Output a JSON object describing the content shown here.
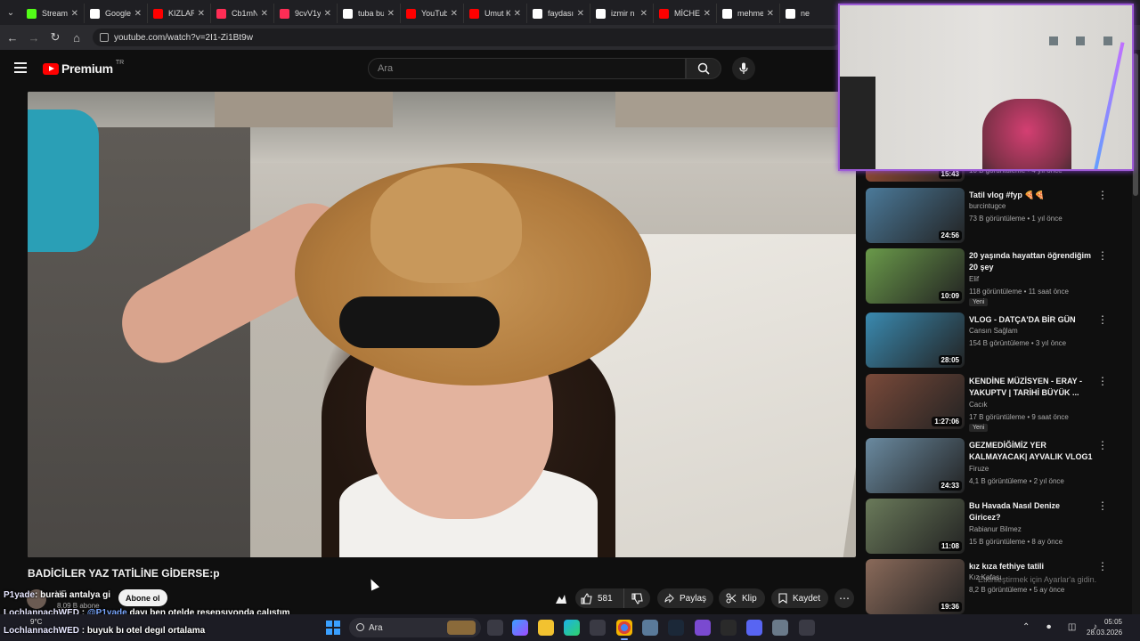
{
  "browser": {
    "tabs": [
      {
        "label": "Stream",
        "icon": "green-k-icon",
        "color": "#53fc18"
      },
      {
        "label": "Google",
        "icon": "google-icon",
        "color": "#ffffff"
      },
      {
        "label": "KIZLAR",
        "icon": "youtube-icon",
        "color": "#ff0000"
      },
      {
        "label": "Cb1mN",
        "icon": "tiktok-icon",
        "color": "#ff2d55"
      },
      {
        "label": "9cvV1y",
        "icon": "tiktok-icon",
        "color": "#ff2d55"
      },
      {
        "label": "tuba bu",
        "icon": "x-icon",
        "color": "#ffffff"
      },
      {
        "label": "YouTub",
        "icon": "youtube-icon",
        "color": "#ff0000"
      },
      {
        "label": "Umut K",
        "icon": "youtube-icon",
        "color": "#ff0000"
      },
      {
        "label": "faydası",
        "icon": "google-icon",
        "color": "#ffffff"
      },
      {
        "label": "izmir n",
        "icon": "google-icon",
        "color": "#ffffff"
      },
      {
        "label": "MİCHE",
        "icon": "youtube-icon",
        "color": "#ff0000"
      },
      {
        "label": "mehme",
        "icon": "google-icon",
        "color": "#ffffff"
      },
      {
        "label": "ne",
        "icon": "google-icon",
        "color": "#ffffff"
      }
    ],
    "url": "youtube.com/watch?v=2I1-Zi1Bt9w"
  },
  "youtube": {
    "logo_text": "Premium",
    "logo_sup": "TR",
    "search_placeholder": "Ara",
    "video_title": "BADİCİLER YAZ TATİLİNE GİDERSE:p",
    "channel": {
      "name": "HE",
      "subs": "8,09 B abone",
      "subscribe_label": "Abone ol"
    },
    "actions": {
      "like_count": "581",
      "share": "Paylaş",
      "clip": "Klip",
      "save": "Kaydet"
    }
  },
  "recommendations": [
    {
      "title": "",
      "channel": "",
      "meta": "10 B görüntüleme • 4 yıl önce",
      "duration": "15:43",
      "new": ""
    },
    {
      "title": "Tatil vlog #fyp 🍕🍕",
      "channel": "burcintugce",
      "meta": "73 B görüntüleme • 1 yıl önce",
      "duration": "24:56",
      "new": ""
    },
    {
      "title": "20 yaşında hayattan öğrendiğim 20 şey",
      "channel": "Elif",
      "meta": "118 görüntüleme • 11 saat önce",
      "duration": "10:09",
      "new": "Yeni"
    },
    {
      "title": "VLOG - DATÇA'DA BİR GÜN",
      "channel": "Cansın Sağlam",
      "meta": "154 B görüntüleme • 3 yıl önce",
      "duration": "28:05",
      "new": ""
    },
    {
      "title": "KENDİNE MÜZİSYEN - ERAY - YAKUPTV | TARİHİ BÜYÜK ...",
      "channel": "Cacık",
      "meta": "17 B görüntüleme • 9 saat önce",
      "duration": "1:27:06",
      "new": "Yeni"
    },
    {
      "title": "GEZMEDİĞİMİZ YER KALMAYACAK| AYVALIK VLOG1",
      "channel": "Firuze",
      "meta": "4,1 B görüntüleme • 2 yıl önce",
      "duration": "24:33",
      "new": ""
    },
    {
      "title": "Bu Havada Nasıl Denize Giricez?",
      "channel": "Rabianur Bilmez",
      "meta": "15 B görüntüleme • 8 ay önce",
      "duration": "11:08",
      "new": ""
    },
    {
      "title": "kız kıza fethiye tatili",
      "channel": "Kız Kafası",
      "meta": "8,2 B görüntüleme • 5 ay önce",
      "duration": "19:36",
      "new": ""
    }
  ],
  "thumb_colors": [
    "#b85a3a",
    "#4b7a9a",
    "#6a9a4a",
    "#3a8ab0",
    "#7a4a3a",
    "#6a8aa0",
    "#6a7a5a",
    "#8a6a5a"
  ],
  "chat": [
    {
      "user": "P1yade",
      "text": ": burası antalya gi"
    },
    {
      "user": "LochlannachWED",
      "mention": "@P1yade",
      "text": " dayı ben otelde resepsıyonda calıstım"
    },
    {
      "user": "LochlannachWED",
      "text": " : buyuk bı otel degıl ortalama"
    }
  ],
  "windows_activate": "Etkinleştirmek için Ayarlar'a gidin.",
  "taskbar": {
    "weather": "9°C",
    "search_placeholder": "Ara",
    "time": "05:05",
    "date": "28.03.2026"
  }
}
